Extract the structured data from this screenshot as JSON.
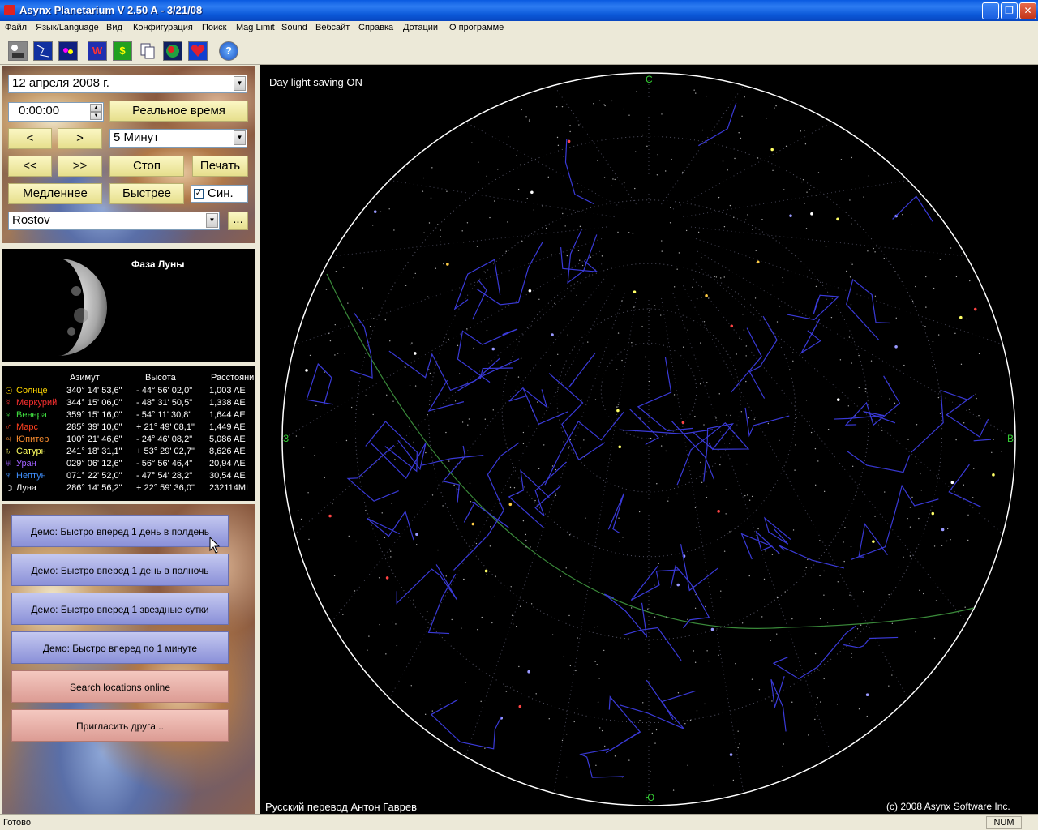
{
  "window": {
    "title": "Asynx Planetarium V 2.50 A - 3/21/08",
    "minimize": "_",
    "maximize": "❐",
    "close": "✕"
  },
  "menu": [
    "Файл",
    "Язык/Language",
    "Вид",
    "Конфигурация",
    "Поиск",
    "Mag Limit",
    "Sound",
    "Вебсайт",
    "Справка",
    "Дотации",
    "О программе"
  ],
  "toolbar": {
    "w_label": "W",
    "dollar_label": "$",
    "help_label": "?"
  },
  "controls": {
    "date": "12   апреля   2008 г.",
    "time": "0:00:00",
    "realtime": "Реальное время",
    "prev": "<",
    "next": ">",
    "step": "5 Минут",
    "fast_prev": "<<",
    "fast_next": ">>",
    "stop": "Стоп",
    "print": "Печать",
    "slower": "Медленнее",
    "faster": "Быстрее",
    "sync_label": "Син.",
    "sync_checked": true,
    "location": "Rostov",
    "browse": "..."
  },
  "moon": {
    "title": "Фаза Луны"
  },
  "planets": {
    "headers": {
      "azimuth": "Азимут",
      "altitude": "Высота",
      "distance": "Расстояни"
    },
    "rows": [
      {
        "sym": "☉",
        "name": "Солнце",
        "az": "340° 14' 53,6\"",
        "alt": "-  44° 56' 02,0\"",
        "dist": "1,003 AE",
        "color": "#ffd700"
      },
      {
        "sym": "☿",
        "name": "Меркурий",
        "az": "344° 15' 06,0\"",
        "alt": "-  48° 31' 50,5\"",
        "dist": "1,338 AE",
        "color": "#ff3030"
      },
      {
        "sym": "♀",
        "name": "Венера",
        "az": "359° 15' 16,0\"",
        "alt": "-  54° 11' 30,8\"",
        "dist": "1,644 AE",
        "color": "#40e040"
      },
      {
        "sym": "♂",
        "name": "Марс",
        "az": "285° 39' 10,6\"",
        "alt": "+ 21° 49' 08,1\"",
        "dist": "1,449 AE",
        "color": "#ff4020"
      },
      {
        "sym": "♃",
        "name": "Юпитер",
        "az": "100° 21' 46,6\"",
        "alt": "-  24° 46' 08,2\"",
        "dist": "5,086 AE",
        "color": "#ff9030"
      },
      {
        "sym": "♄",
        "name": "Сатурн",
        "az": "241° 18' 31,1\"",
        "alt": "+ 53° 29' 02,7\"",
        "dist": "8,626 AE",
        "color": "#ffff60"
      },
      {
        "sym": "♅",
        "name": "Уран",
        "az": "029° 06' 12,6\"",
        "alt": "-  56° 56' 46,4\"",
        "dist": "20,94 AE",
        "color": "#a060ff"
      },
      {
        "sym": "♆",
        "name": "Нептун",
        "az": "071° 22' 52,0\"",
        "alt": "-  47° 54' 28,2\"",
        "dist": "30,54 AE",
        "color": "#4090ff"
      },
      {
        "sym": "☽",
        "name": "Луна",
        "az": "286° 14' 56,2\"",
        "alt": "+ 22° 59' 36,0\"",
        "dist": "232114MI",
        "color": "#ffffff"
      }
    ]
  },
  "demo": {
    "b1": "Демо: Быстро вперед 1 день в полдень",
    "b2": "Демо: Быстро вперед 1 день в полночь",
    "b3": "Демо: Быстро вперед 1 звездные сутки",
    "b4": "Демо: Быстро вперед по 1 минуте",
    "b5": "Search locations online",
    "b6": "Пригласить друга .."
  },
  "sky": {
    "dst": "Day light saving ON",
    "north": "С",
    "south": "Ю",
    "east": "В",
    "west": "З",
    "credit_left": "Русский перевод Антон Гаврев",
    "credit_right": "(c) 2008 Asynx Software Inc."
  },
  "status": {
    "text": "Готово",
    "num": "NUM"
  }
}
